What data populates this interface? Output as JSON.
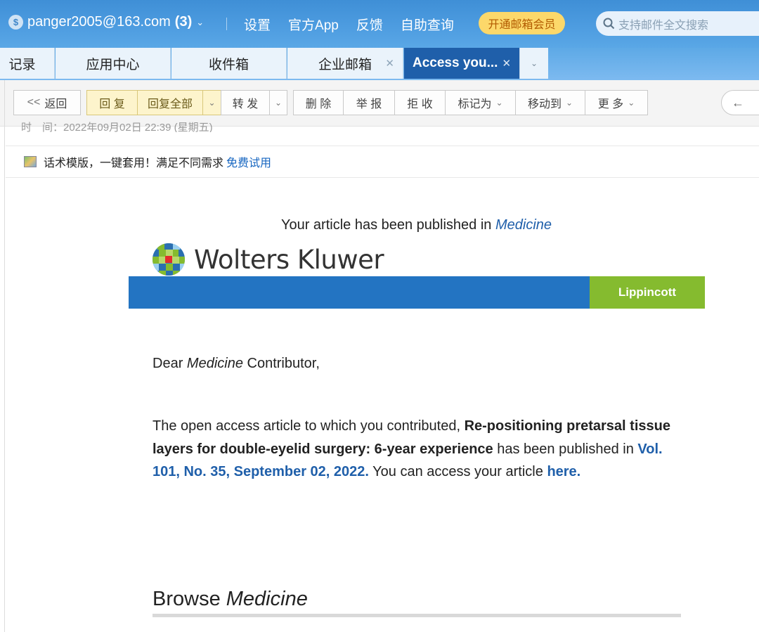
{
  "topbar": {
    "account": "panger2005@163.com",
    "unread": "(3)",
    "links": [
      "设置",
      "官方App",
      "反馈",
      "自助查询"
    ],
    "vip_label": "开通邮箱会员",
    "search_placeholder": "支持邮件全文搜索"
  },
  "tabs": [
    {
      "label": "记录"
    },
    {
      "label": "应用中心"
    },
    {
      "label": "收件箱"
    },
    {
      "label": "企业邮箱"
    },
    {
      "label": "Access you..."
    }
  ],
  "toolbar": {
    "back": "返回",
    "reply": "回 复",
    "reply_all": "回复全部",
    "forward": "转 发",
    "delete": "删 除",
    "report": "举 报",
    "reject": "拒 收",
    "mark_as": "标记为",
    "move_to": "移动到",
    "more": "更 多"
  },
  "meta": {
    "time_row": "时　间：2022年09月02日 22:39 (星期五)"
  },
  "ad": {
    "text": "话术模版，一键套用！满足不同需求",
    "link": "免费试用"
  },
  "email": {
    "published_prefix": "Your article has been published in ",
    "journal": "Medicine",
    "brand": "Wolters Kluwer",
    "imprint": "Lippincott",
    "dear_prefix": "Dear ",
    "dear_suffix": " Contributor,",
    "para_1": "The open access article to which you contributed, ",
    "article_title": "Re-positioning pretarsal tissue layers for double-eyelid surgery: 6-year experience",
    "para_2": " has been published in ",
    "issue": "Vol. 101, No. 35, September 02, 2022.",
    "para_3": " You can access your article ",
    "here": "here.",
    "browse_prefix": "Browse "
  },
  "colors": {
    "banner_blue": "#2374c2",
    "lippincott_green": "#85bb2f",
    "tab_active": "#1f5faa",
    "vip_yellow": "#fcd86a"
  }
}
